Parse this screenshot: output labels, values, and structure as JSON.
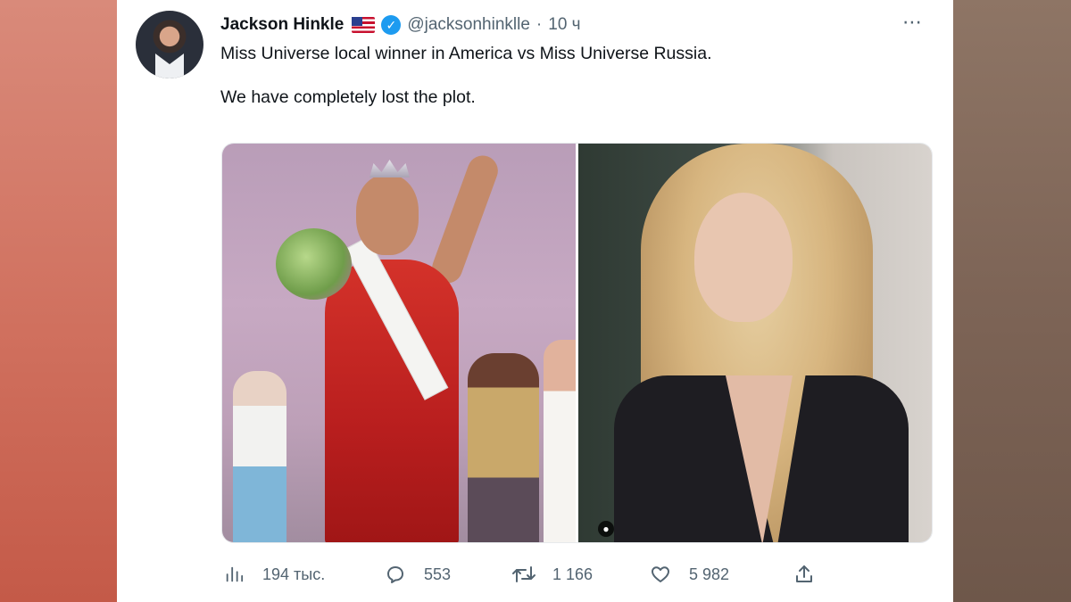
{
  "tweet": {
    "author_name": "Jackson Hinkle",
    "handle": "@jacksonhinklle",
    "separator": "·",
    "time": "10 ч",
    "text_line1": "Miss Universe local winner in America vs Miss Universe Russia.",
    "text_line2": "We have completely lost the plot.",
    "more_icon": "⋯"
  },
  "actions": {
    "views": "194 тыс.",
    "replies": "553",
    "retweets": "1 166",
    "likes": "5 982"
  },
  "colors": {
    "accent": "#1d9bf0",
    "text": "#0f1419",
    "muted": "#536471"
  },
  "icons": [
    "views-icon",
    "reply-icon",
    "retweet-icon",
    "like-icon",
    "share-icon",
    "verified-icon",
    "us-flag-icon",
    "more-icon",
    "camera-icon"
  ]
}
